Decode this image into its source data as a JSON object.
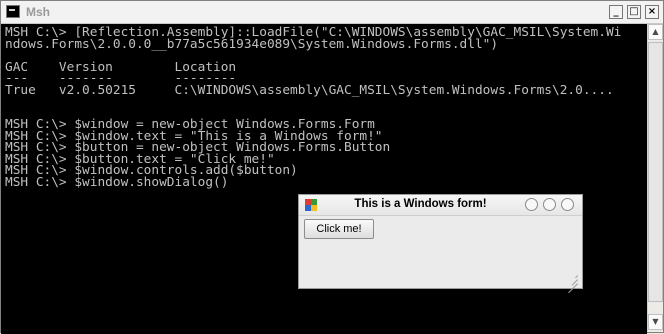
{
  "console_window": {
    "title": "Msh",
    "caption_buttons": {
      "minimize": "_",
      "maximize": "□",
      "close": "×"
    },
    "lines": [
      "MSH C:\\> [Reflection.Assembly]::LoadFile(\"C:\\WINDOWS\\assembly\\GAC_MSIL\\System.Wi",
      "ndows.Forms\\2.0.0.0__b77a5c561934e089\\System.Windows.Forms.dll\")",
      "",
      "GAC    Version        Location",
      "---    -------        --------",
      "True   v2.0.50215     C:\\WINDOWS\\assembly\\GAC_MSIL\\System.Windows.Forms\\2.0....",
      "",
      "",
      "MSH C:\\> $window = new-object Windows.Forms.Form",
      "MSH C:\\> $window.text = \"This is a Windows form!\"",
      "MSH C:\\> $button = new-object Windows.Forms.Button",
      "MSH C:\\> $button.text = \"Click me!\"",
      "MSH C:\\> $window.controls.add($button)",
      "MSH C:\\> $window.showDialog()"
    ],
    "colors": {
      "background": "#000000",
      "text": "#c0c0c0"
    }
  },
  "form_window": {
    "title": "This is a Windows form!",
    "button_label": "Click me!"
  }
}
